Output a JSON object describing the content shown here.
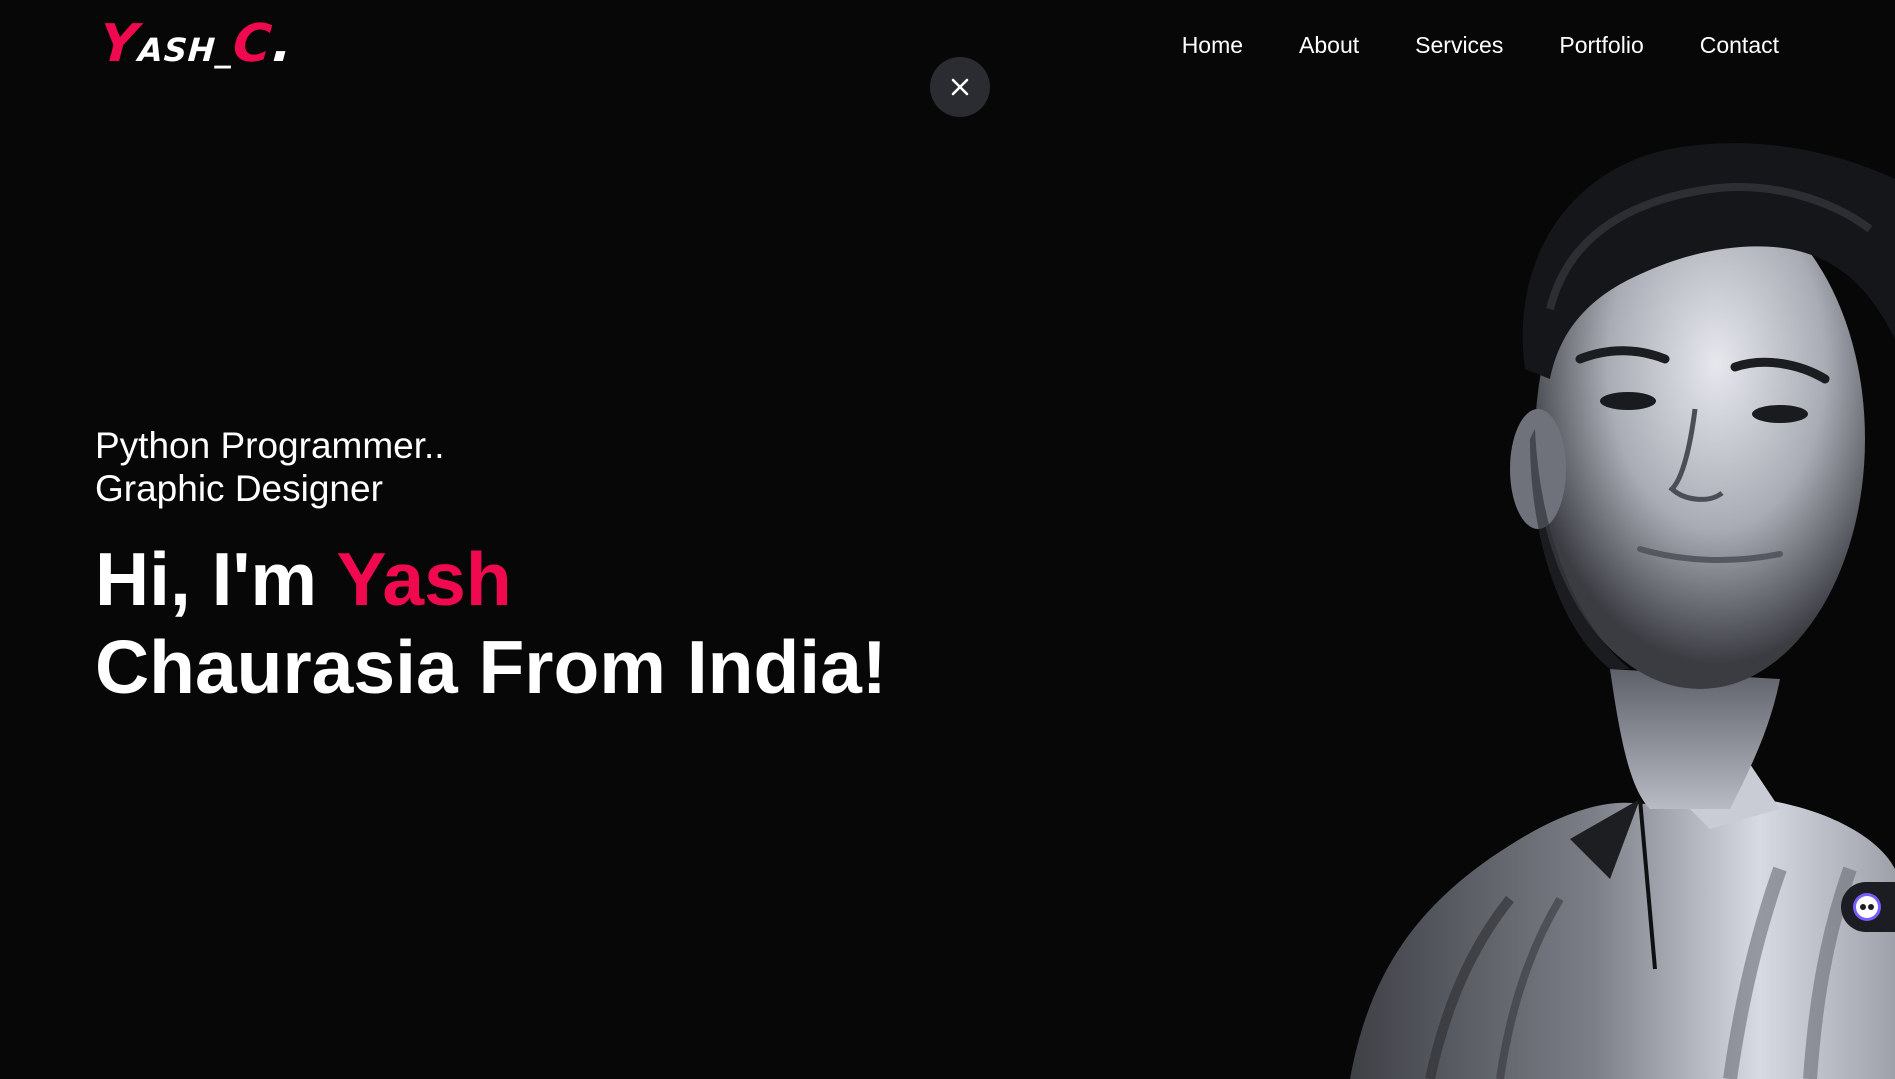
{
  "brand": {
    "logo_part1": "Y",
    "logo_part2": "ASH_",
    "logo_part3": "C",
    "logo_part4": ".",
    "accent_color": "#f0094e"
  },
  "nav": {
    "items": [
      {
        "label": "Home"
      },
      {
        "label": "About"
      },
      {
        "label": "Services"
      },
      {
        "label": "Portfolio"
      },
      {
        "label": "Contact"
      }
    ]
  },
  "overlay": {
    "close_icon": "close-icon"
  },
  "hero": {
    "roles": [
      "Python Programmer..",
      "Graphic Designer"
    ],
    "greeting_prefix": "Hi, I'm ",
    "greeting_name": "Yash",
    "line2": "Chaurasia From India!"
  },
  "widget": {
    "icon": "chat-assistant-icon"
  }
}
